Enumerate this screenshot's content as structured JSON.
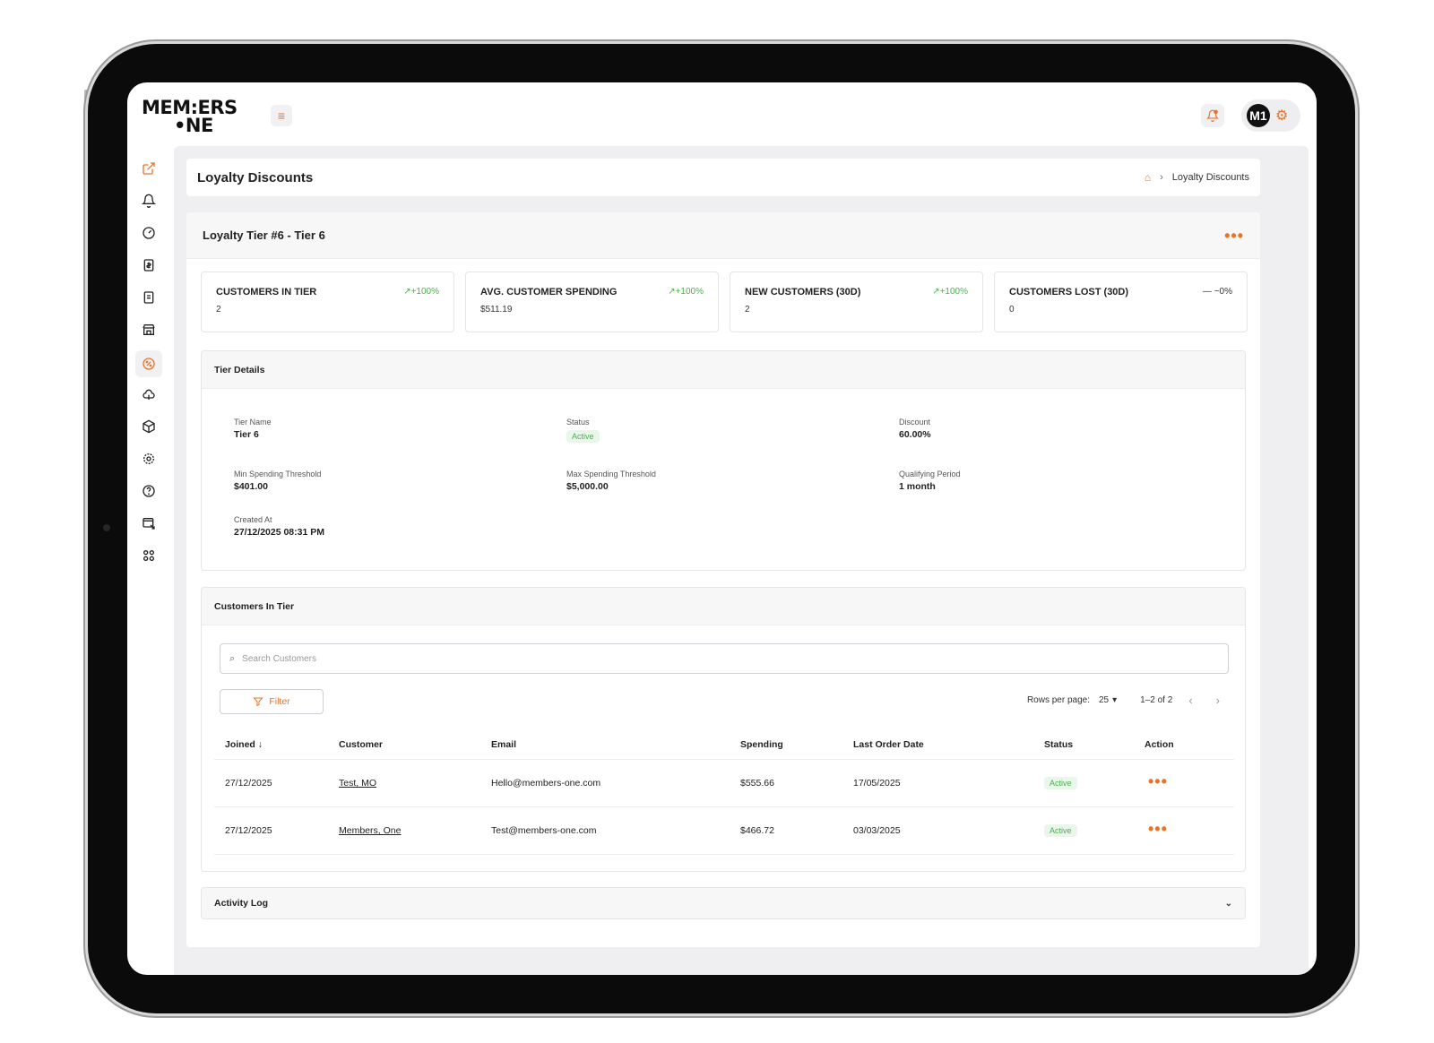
{
  "brand": {
    "logo_line1": "MEM:ERS",
    "logo_line2": "•NE"
  },
  "header": {
    "avatar_initials": "M1"
  },
  "page": {
    "title": "Loyalty Discounts"
  },
  "breadcrumb": {
    "current": "Loyalty Discounts"
  },
  "tier": {
    "title": "Loyalty Tier #6 - Tier 6"
  },
  "stats": [
    {
      "label": "CUSTOMERS IN TIER",
      "value": "2",
      "trend": "+100%"
    },
    {
      "label": "AVG. CUSTOMER SPENDING",
      "value": "$511.19",
      "trend": "+100%"
    },
    {
      "label": "NEW CUSTOMERS (30D)",
      "value": "2",
      "trend": "+100%"
    },
    {
      "label": "CUSTOMERS LOST (30D)",
      "value": "0",
      "trend": "~0%"
    }
  ],
  "details": {
    "heading": "Tier Details",
    "tier_name_label": "Tier Name",
    "tier_name": "Tier 6",
    "status_label": "Status",
    "status": "Active",
    "discount_label": "Discount",
    "discount": "60.00%",
    "min_label": "Min Spending Threshold",
    "min": "$401.00",
    "max_label": "Max Spending Threshold",
    "max": "$5,000.00",
    "period_label": "Qualifying Period",
    "period": "1 month",
    "created_label": "Created At",
    "created": "27/12/2025 08:31 PM"
  },
  "customers": {
    "heading": "Customers In Tier",
    "search_placeholder": "Search Customers",
    "filter_label": "Filter",
    "rows_per_page_label": "Rows per page:",
    "rows_per_page": "25",
    "range": "1–2 of 2",
    "columns": [
      "Joined",
      "Customer",
      "Email",
      "Spending",
      "Last Order Date",
      "Status",
      "Action"
    ],
    "rows": [
      {
        "joined": "27/12/2025",
        "customer": "Test, MO",
        "email": "Hello@members-one.com",
        "spending": "$555.66",
        "last_order": "17/05/2025",
        "status": "Active"
      },
      {
        "joined": "27/12/2025",
        "customer": "Members, One",
        "email": "Test@members-one.com",
        "spending": "$466.72",
        "last_order": "03/03/2025",
        "status": "Active"
      }
    ]
  },
  "activity": {
    "heading": "Activity Log"
  },
  "colors": {
    "accent": "#e8742a",
    "success": "#4caf50",
    "background": "#efeff2"
  },
  "icons": {
    "sidebar": [
      "external-link-icon",
      "bell-icon",
      "dashboard-icon",
      "receipt-icon",
      "wallet-icon",
      "store-icon",
      "discount-icon",
      "cloud-icon",
      "box-icon",
      "settings-icon",
      "help-icon",
      "browser-icon",
      "integrations-icon"
    ]
  }
}
